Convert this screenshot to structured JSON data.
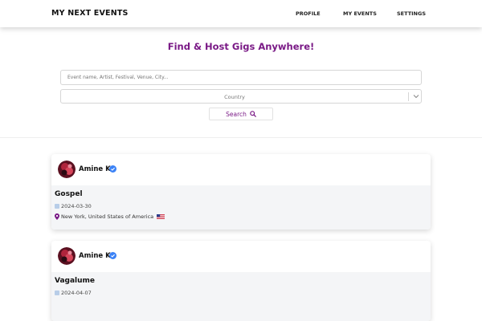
{
  "header": {
    "brand": "MY NEXT EVENTS",
    "nav": [
      "PROFILE",
      "MY EVENTS",
      "SETTINGS"
    ]
  },
  "hero": {
    "headline": "Find & Host Gigs Anywhere!",
    "search_placeholder": "Event name, Artist, Festival, Venue, City...",
    "country_placeholder": "Country",
    "search_label": "Search"
  },
  "events": [
    {
      "host": "Amine K",
      "title": "Gospel",
      "date": "2024-03-30",
      "location": "New York, United States of America"
    },
    {
      "host": "Amine K",
      "title": "Vagalume",
      "date": "2024-04-07"
    }
  ],
  "colors": {
    "accent": "#7a1a86",
    "verified": "#3b82f6",
    "card_body_bg": "#f4f5f7"
  },
  "icons": {
    "verified": "check-badge",
    "calendar": "calendar",
    "location": "map-pin",
    "search": "magnifier",
    "flag": "us-flag"
  }
}
